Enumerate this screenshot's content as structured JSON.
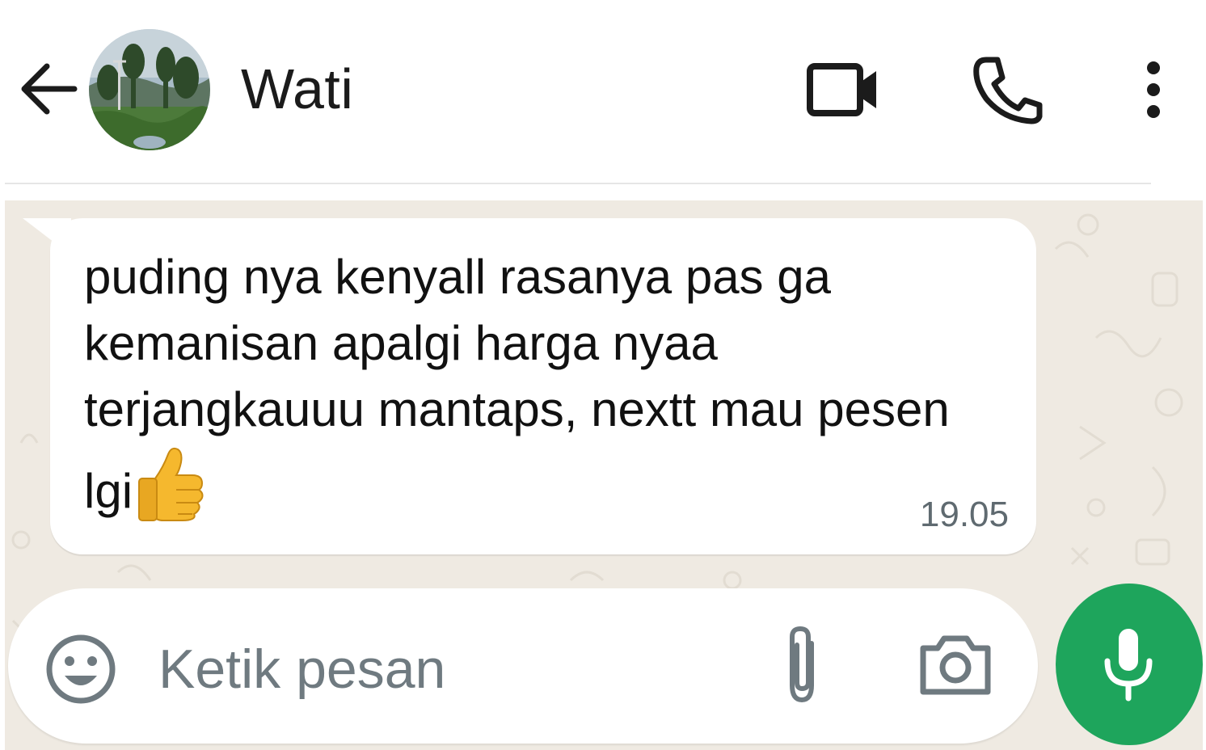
{
  "header": {
    "contact_name": "Wati"
  },
  "message": {
    "text": "puding nya kenyall rasanya pas ga kemanisan apalgi harga nyaa terjangkauuu mantaps, nextt mau pesen lgi",
    "emoji": "thumbs-up",
    "time": "19.05"
  },
  "composer": {
    "placeholder": "Ketik pesan",
    "value": ""
  },
  "icons": {
    "back": "arrow-left-icon",
    "video": "video-camera-icon",
    "call": "phone-icon",
    "menu": "more-vertical-icon",
    "emoji": "smiley-icon",
    "attach": "paperclip-icon",
    "camera": "camera-icon",
    "mic": "microphone-icon"
  },
  "colors": {
    "chat_background": "#efeae2",
    "mic_button": "#1ea55c",
    "bubble": "#ffffff"
  }
}
